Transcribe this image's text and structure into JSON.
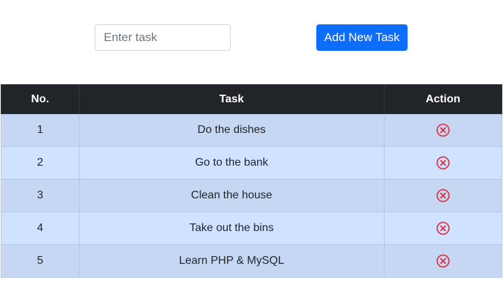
{
  "form": {
    "input_value": "",
    "input_placeholder": "Enter task",
    "add_button_label": "Add New Task",
    "accent_color": "#0d6efd"
  },
  "table": {
    "headers": {
      "number": "No.",
      "task": "Task",
      "action": "Action"
    },
    "rows": [
      {
        "number": "1",
        "task": "Do the dishes",
        "action_icon": "delete-circle-x-icon"
      },
      {
        "number": "2",
        "task": "Go to the bank",
        "action_icon": "delete-circle-x-icon"
      },
      {
        "number": "3",
        "task": "Clean the house",
        "action_icon": "delete-circle-x-icon"
      },
      {
        "number": "4",
        "task": "Take out the bins",
        "action_icon": "delete-circle-x-icon"
      },
      {
        "number": "5",
        "task": "Learn PHP & MySQL",
        "action_icon": "delete-circle-x-icon"
      }
    ],
    "header_color": "#212529",
    "row_color_odd": "#c5d7f2",
    "row_color_even": "#cfe2ff",
    "delete_icon_color": "#dc3545"
  }
}
